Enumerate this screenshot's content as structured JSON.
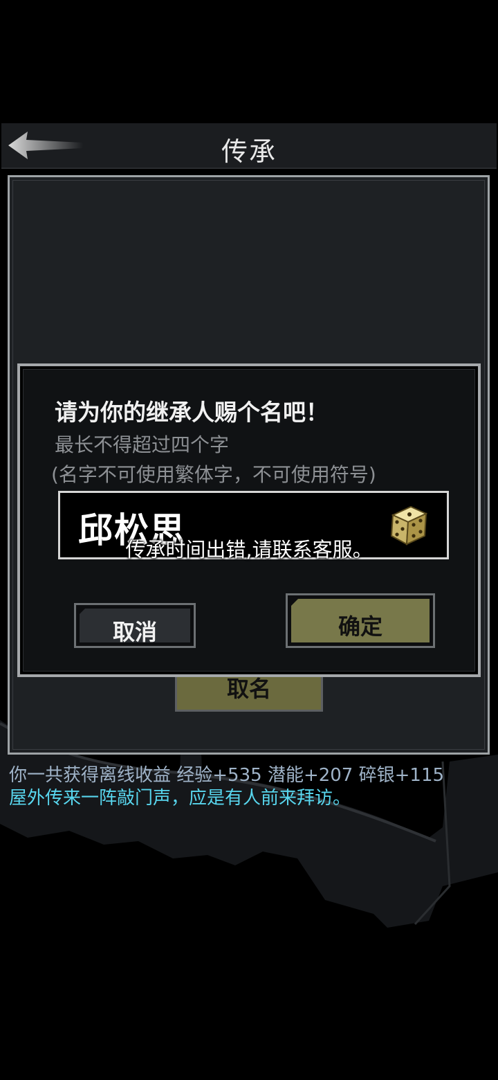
{
  "header": {
    "title": "传承",
    "back_icon": "back-arrow-icon"
  },
  "main": {
    "name_button_label": "取名"
  },
  "log": {
    "line1": "你一共获得离线收益 经验+535 潜能+207 碎银+115",
    "line2": "屋外传来一阵敲门声，应是有人前来拜访。"
  },
  "dialog": {
    "title": "请为你的继承人赐个名吧！",
    "hint1": "最长不得超过四个字",
    "hint2": "(名字不可使用繁体字，不可使用符号)",
    "name_value": "邱松思",
    "dice_icon": "dice-icon",
    "cancel_label": "取消",
    "confirm_label": "确定"
  },
  "toast": {
    "message": "传承时间出错,请联系客服。"
  },
  "colors": {
    "confirm_fill": "#78784a",
    "log_income": "#9fb3c8",
    "log_event": "#58d6ee",
    "panel_border": "#9ea3a6"
  }
}
